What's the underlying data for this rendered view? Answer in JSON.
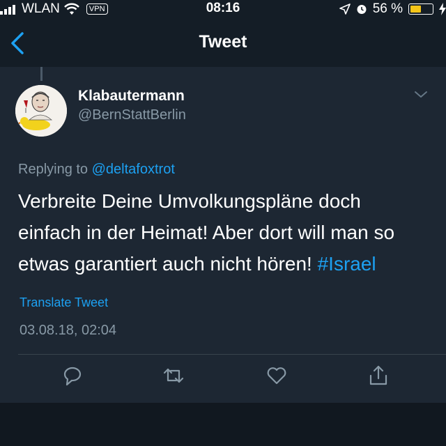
{
  "status": {
    "carrier": "WLAN",
    "vpn": "VPN",
    "time": "08:16",
    "battery": "56 %",
    "battery_level": 0.56,
    "battery_color": "#f5c518"
  },
  "nav": {
    "title": "Tweet",
    "back_icon": "chevron-left-icon"
  },
  "tweet": {
    "author": {
      "name": "Klabautermann",
      "handle": "@BernStattBerlin"
    },
    "replying_to_label": "Replying to",
    "replying_to_handle": "@deltafoxtrot",
    "text_lines": [
      "Verbreite Deine Umvolkungspläne doch",
      "einfach in der Heimat! Aber dort will man so",
      "etwas garantiert auch nicht hören! "
    ],
    "hashtag": "#Israel",
    "translate": "Translate Tweet",
    "timestamp": "03.08.18, 02:04"
  },
  "actions": [
    "reply-icon",
    "retweet-icon",
    "like-icon",
    "share-icon"
  ],
  "colors": {
    "accent": "#1da1f2",
    "background": "#141d26",
    "card": "#1d2733",
    "secondary_text": "#8899a6"
  }
}
